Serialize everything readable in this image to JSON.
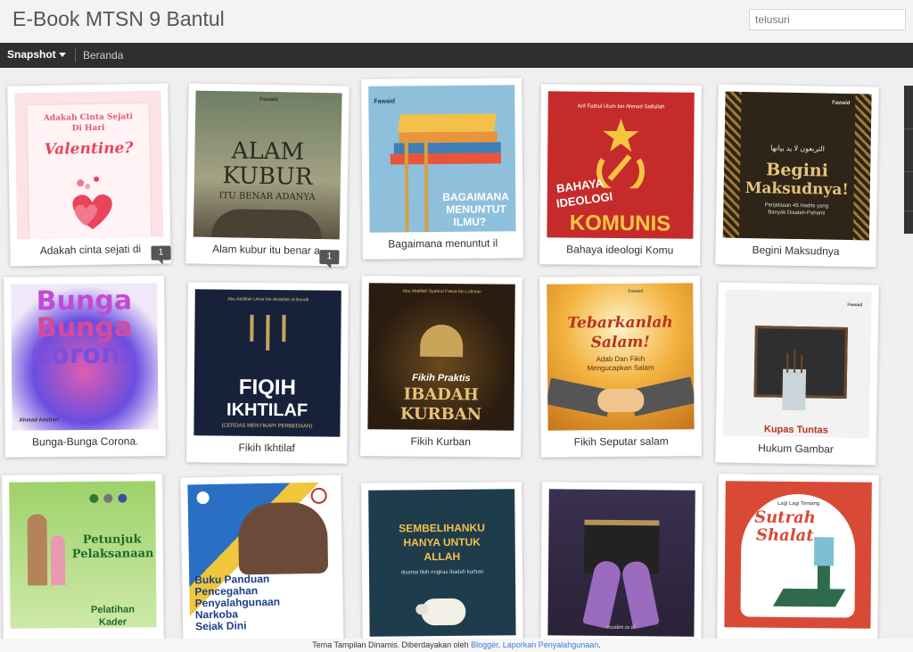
{
  "header": {
    "title": "E-Book MTSN 9 Bantul",
    "search_placeholder": "telusuri"
  },
  "nav": {
    "view_label": "Snapshot",
    "home_link": "Beranda"
  },
  "posts": [
    {
      "caption": "Adakah cinta sejati di",
      "cover_lines": [
        "Adakah Cinta Sejati",
        "Di Hari",
        "Valentine?"
      ],
      "comments": "1"
    },
    {
      "caption": "Alam kubur itu benar a",
      "cover_brand": "Fawaid",
      "cover_lines": [
        "ALAM",
        "KUBUR",
        "ITU BENAR ADANYA"
      ],
      "comments": "1"
    },
    {
      "caption": "Bagaimana menuntut il",
      "cover_brand": "Fawaid",
      "cover_lines": [
        "BAGAIMANA",
        "MENUNTUT",
        "ILMU?"
      ]
    },
    {
      "caption": "Bahaya ideologi Komu",
      "cover_author": "Arif Fathul Ulum bin Ahmad Saifullah",
      "cover_lines": [
        "BAHAYA",
        "IDEOLOGI",
        "KOMUNIS"
      ]
    },
    {
      "caption": "Begini Maksudnya",
      "cover_brand": "Fawaid",
      "cover_arabic": "التربعون لا يد بيانها",
      "cover_lines": [
        "Begini",
        "Maksudnya!",
        "Penjelasan 45 Hadits yang",
        "Banyak Disalah-Pahami"
      ]
    },
    {
      "caption": "Bunga-Bunga Corona.",
      "cover_lines": [
        "Bunga",
        "Bunga",
        "Corona"
      ],
      "cover_author": "Ahmad Anshori"
    },
    {
      "caption": "Fikih Ikhtilaf",
      "cover_author": "Abu Abdillah Umar bin Abdullah al-Buraik",
      "cover_lines": [
        "FIQIH",
        "IKHTILAF",
        "(CERDAS MENYIKAPI PERBEDAAN)"
      ]
    },
    {
      "caption": "Fikih Kurban",
      "cover_author": "Abu Abdillah Syahrul Fatwa bin Lukman",
      "cover_lines": [
        "Fikih Praktis",
        "IBADAH",
        "KURBAN"
      ]
    },
    {
      "caption": "Fikih Seputar salam",
      "cover_brand": "Fawaid",
      "cover_lines": [
        "Tebarkanlah",
        "Salam!",
        "Adab Dan Fikih",
        "Mengucapkan Salam"
      ]
    },
    {
      "caption": "Hukum Gambar",
      "cover_brand": "Fawaid",
      "cover_lines": [
        "Kupas Tuntas"
      ]
    },
    {
      "caption": "",
      "cover_lines": [
        "Petunjuk",
        "Pelaksanaan",
        "Pelatihan",
        "Kader"
      ]
    },
    {
      "caption": "",
      "cover_lines": [
        "Buku Panduan",
        "Pencegahan",
        "Penyalahgunaan",
        "Narkoba",
        "Sejak Dini"
      ]
    },
    {
      "caption": "",
      "cover_lines": [
        "SEMBELIHANKU",
        "HANYA UNTUK",
        "ALLAH",
        "disertai fikih ringkas ibadah kurban"
      ]
    },
    {
      "caption": "",
      "cover_brand": "muslim.or.id"
    },
    {
      "caption": "",
      "cover_lines": [
        "Lagi Lagi Tentang",
        "Sutrah",
        "Shalat"
      ]
    }
  ],
  "footer": {
    "text": "Tema Tampilan Dinamis. Diberdayakan oleh",
    "link1": "Blogger",
    "sep": ".",
    "link2": "Laporkan Penyalahgunaan",
    "end": "."
  },
  "colors": {
    "navbar": "#2f2f2f",
    "link": "#3a7bd5",
    "badge": "#555555"
  }
}
